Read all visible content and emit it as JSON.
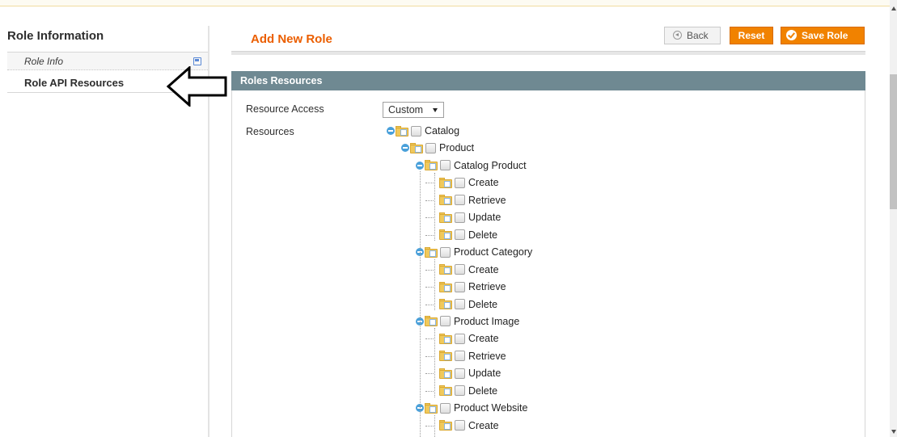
{
  "sidebar": {
    "title": "Role Information",
    "tabs": [
      {
        "label": "Role Info",
        "icon": "save-icon"
      },
      {
        "label": "Role API Resources"
      }
    ]
  },
  "annotation": {
    "icon": "left-arrow-icon"
  },
  "header": {
    "title": "Add New Role",
    "buttons": {
      "back": "Back",
      "reset": "Reset",
      "save": "Save Role"
    }
  },
  "section": {
    "title": "Roles Resources",
    "resource_access_label": "Resource Access",
    "resource_access_value": "Custom",
    "resources_label": "Resources"
  },
  "tree": [
    {
      "label": "Catalog",
      "level": 0,
      "toggle": true
    },
    {
      "label": "Product",
      "level": 1,
      "toggle": true
    },
    {
      "label": "Catalog Product",
      "level": 2,
      "toggle": true
    },
    {
      "label": "Create",
      "level": 3,
      "toggle": false
    },
    {
      "label": "Retrieve",
      "level": 3,
      "toggle": false
    },
    {
      "label": "Update",
      "level": 3,
      "toggle": false
    },
    {
      "label": "Delete",
      "level": 3,
      "toggle": false
    },
    {
      "label": "Product Category",
      "level": 2,
      "toggle": true
    },
    {
      "label": "Create",
      "level": 3,
      "toggle": false
    },
    {
      "label": "Retrieve",
      "level": 3,
      "toggle": false
    },
    {
      "label": "Delete",
      "level": 3,
      "toggle": false
    },
    {
      "label": "Product Image",
      "level": 2,
      "toggle": true
    },
    {
      "label": "Create",
      "level": 3,
      "toggle": false
    },
    {
      "label": "Retrieve",
      "level": 3,
      "toggle": false
    },
    {
      "label": "Update",
      "level": 3,
      "toggle": false
    },
    {
      "label": "Delete",
      "level": 3,
      "toggle": false
    },
    {
      "label": "Product Website",
      "level": 2,
      "toggle": true
    },
    {
      "label": "Create",
      "level": 3,
      "toggle": false
    }
  ],
  "colors": {
    "accent": "#eb5e00",
    "button": "#f18200",
    "section_header": "#6f8992",
    "tree_toggle": "#49a0da"
  }
}
